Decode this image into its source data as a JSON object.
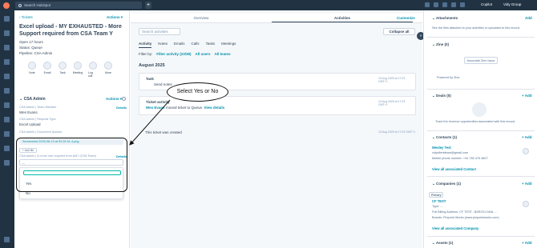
{
  "topbar": {
    "search_placeholder": "Search HubSpot",
    "copilot": "Copilot",
    "user_org": "Vidy Group"
  },
  "record": {
    "back_label": "Tickets",
    "actions_label": "Actions",
    "title": "Excel upload - MY EXHAUSTED - More Support required from CSA Team Y",
    "open_line": "Open 17 hours",
    "status_line": "Status: Queue",
    "pipeline_line": "Pipeline: CSA Admin",
    "quick_actions": [
      "Note",
      "Email",
      "Task",
      "Meeting",
      "Log call",
      "More"
    ],
    "section_title": "CSA Admin",
    "section_actions": "Actions",
    "details_label": "Details",
    "props": [
      {
        "label": "CSA Admin | Team Member",
        "value": "Wes Evans"
      },
      {
        "label": "CSA Admin | Request Type",
        "value": "Excel Upload"
      },
      {
        "label": "CSA Admin | Document Upload",
        "value": ""
      }
    ],
    "file_name": "Screenshot 2025-08-13 at 09.26.31-4.png",
    "add_file_label": "+ Add file",
    "dropdown_label": "CSA Admin | Is more info required from AM? (CSA Team)",
    "dropdown_value": "--",
    "options": [
      "Yes",
      "No"
    ]
  },
  "middle": {
    "tabs": [
      "Overview",
      "Activities"
    ],
    "customize": "Customize",
    "search_placeholder": "Search activities",
    "collapse_all": "Collapse all",
    "subtabs": [
      "Activity",
      "Notes",
      "Emails",
      "Calls",
      "Tasks",
      "Meetings"
    ],
    "filter_prefix": "Filter by:",
    "filter_activity": "Filter activity (23/39)",
    "filter_users": "All users",
    "filter_teams": "All teams",
    "month": "August 2025",
    "task": {
      "title": "Task",
      "assigned": "Send notes",
      "timestamp": "13 Aug 2025 at 17:23 GMT+1"
    },
    "ticket_activity": {
      "title": "Ticket activity",
      "body_user": "Wes Evans",
      "body_text": "moved ticket to Queue.",
      "link": "View details",
      "timestamp": "13 Aug 2025 at 17:23 GMT+1"
    },
    "created_text": "This ticket was created",
    "created_timestamp": "13 Aug 2025 at 17:23 GMT+1"
  },
  "annotation": {
    "callout": "Select Yes or No"
  },
  "right": {
    "attachments_title": "Attachments",
    "attachments_add": "Add",
    "attachments_text": "See the files attached to your activities or uploaded to this record.",
    "zine_title": "Zine (0)",
    "zine_button": "Associate Zine Issue",
    "zine_powered": "Powered by Zine",
    "deals_title": "Deals (0)",
    "deals_add": "+ Add",
    "deals_text": "Track the revenue opportunities associated with this record.",
    "contacts_title": "Contacts (1)",
    "contacts_add": "+ Add",
    "contact_name": "Wesley Test",
    "contact_email": "vidyclientteam@gmail.com",
    "contact_phone": "Mobile phone number: +44 783 476 4807",
    "contacts_view_all": "View all associated Contact",
    "companies_title": "Companies (1)",
    "companies_add": "+ Add",
    "primary_badge": "Primary",
    "company_name": "CF TEST",
    "company_type": "Type: --",
    "company_address": "Full Billing Address: CF TEST., BARCELONA, ...",
    "company_brands": "Brands: Pinpoint Works (www.pinpointworks.com)",
    "companies_view_all": "View all associated Company",
    "assets_title": "Assets (1)",
    "assets_add": "+ Add"
  }
}
